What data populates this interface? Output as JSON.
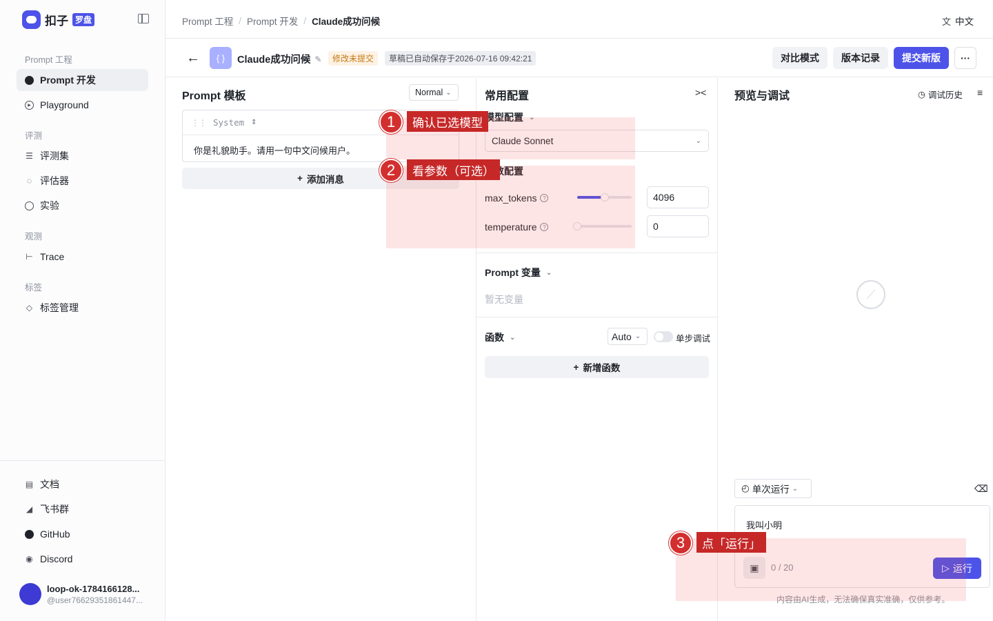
{
  "brand": {
    "name": "扣子",
    "badge": "罗盘"
  },
  "sidebar": {
    "sections": {
      "prompt": "Prompt 工程",
      "eval": "评测",
      "observe": "观测",
      "tags": "标签"
    },
    "items": [
      {
        "label": "Prompt 开发",
        "icon": "prompt-chat-icon",
        "active": true
      },
      {
        "label": "Playground",
        "icon": "play-icon"
      },
      {
        "label": "评测集",
        "icon": "database-icon"
      },
      {
        "label": "评估器",
        "icon": "bulb-icon"
      },
      {
        "label": "实验",
        "icon": "gauge-icon"
      },
      {
        "label": "Trace",
        "icon": "trace-icon"
      },
      {
        "label": "标签管理",
        "icon": "tag-icon"
      }
    ],
    "bottom": [
      {
        "label": "文档",
        "icon": "doc-icon"
      },
      {
        "label": "飞书群",
        "icon": "feishu-icon"
      },
      {
        "label": "GitHub",
        "icon": "github-icon"
      },
      {
        "label": "Discord",
        "icon": "discord-icon"
      }
    ],
    "user": {
      "name": "loop-ok-1784166128...",
      "id": "@user76629351861447..."
    }
  },
  "breadcrumb": [
    "Prompt 工程",
    "Prompt 开发",
    "Claude成功问候"
  ],
  "language": "中文",
  "header": {
    "prompt_icon": "{ }",
    "title": "Claude成功问候",
    "status": "修改未提交",
    "saved": "草稿已自动保存于2026-07-16 09:42:21",
    "buttons": {
      "compare": "对比模式",
      "history": "版本记录",
      "submit": "提交新版",
      "more": "···"
    }
  },
  "template_panel": {
    "title": "Prompt 模板",
    "mode": "Normal",
    "message": {
      "role": "System",
      "content": "你是礼貌助手。请用一句中文问候用户。"
    },
    "add_message": "添加消息"
  },
  "config_panel": {
    "title": "常用配置",
    "model_section": "模型配置",
    "model": "Claude Sonnet",
    "params_section": "参数配置",
    "params": [
      {
        "label": "max_tokens",
        "value": "4096",
        "fraction": 0.5
      },
      {
        "label": "temperature",
        "value": "0",
        "fraction": 0
      }
    ],
    "vars_section": "Prompt 变量",
    "vars_empty": "暂无变量",
    "func_section": "函数",
    "func_mode": "Auto",
    "step_debug": "单步调试",
    "add_function": "新增函数"
  },
  "preview_panel": {
    "title": "预览与调试",
    "history": "调试历史",
    "run_mode": "单次运行",
    "input": "我叫小明",
    "counter": "0 / 20",
    "run": "运行",
    "disclaimer": "内容由AI生成，无法确保真实准确，仅供参考。"
  },
  "annotations": [
    {
      "num": "1",
      "text": "确认已选模型"
    },
    {
      "num": "2",
      "text": "看参数（可选）"
    },
    {
      "num": "3",
      "text": "点「运行」"
    }
  ],
  "colors": {
    "accent": "#4d53e8",
    "annotation": "#c62828",
    "warn_text": "#c67a15"
  }
}
